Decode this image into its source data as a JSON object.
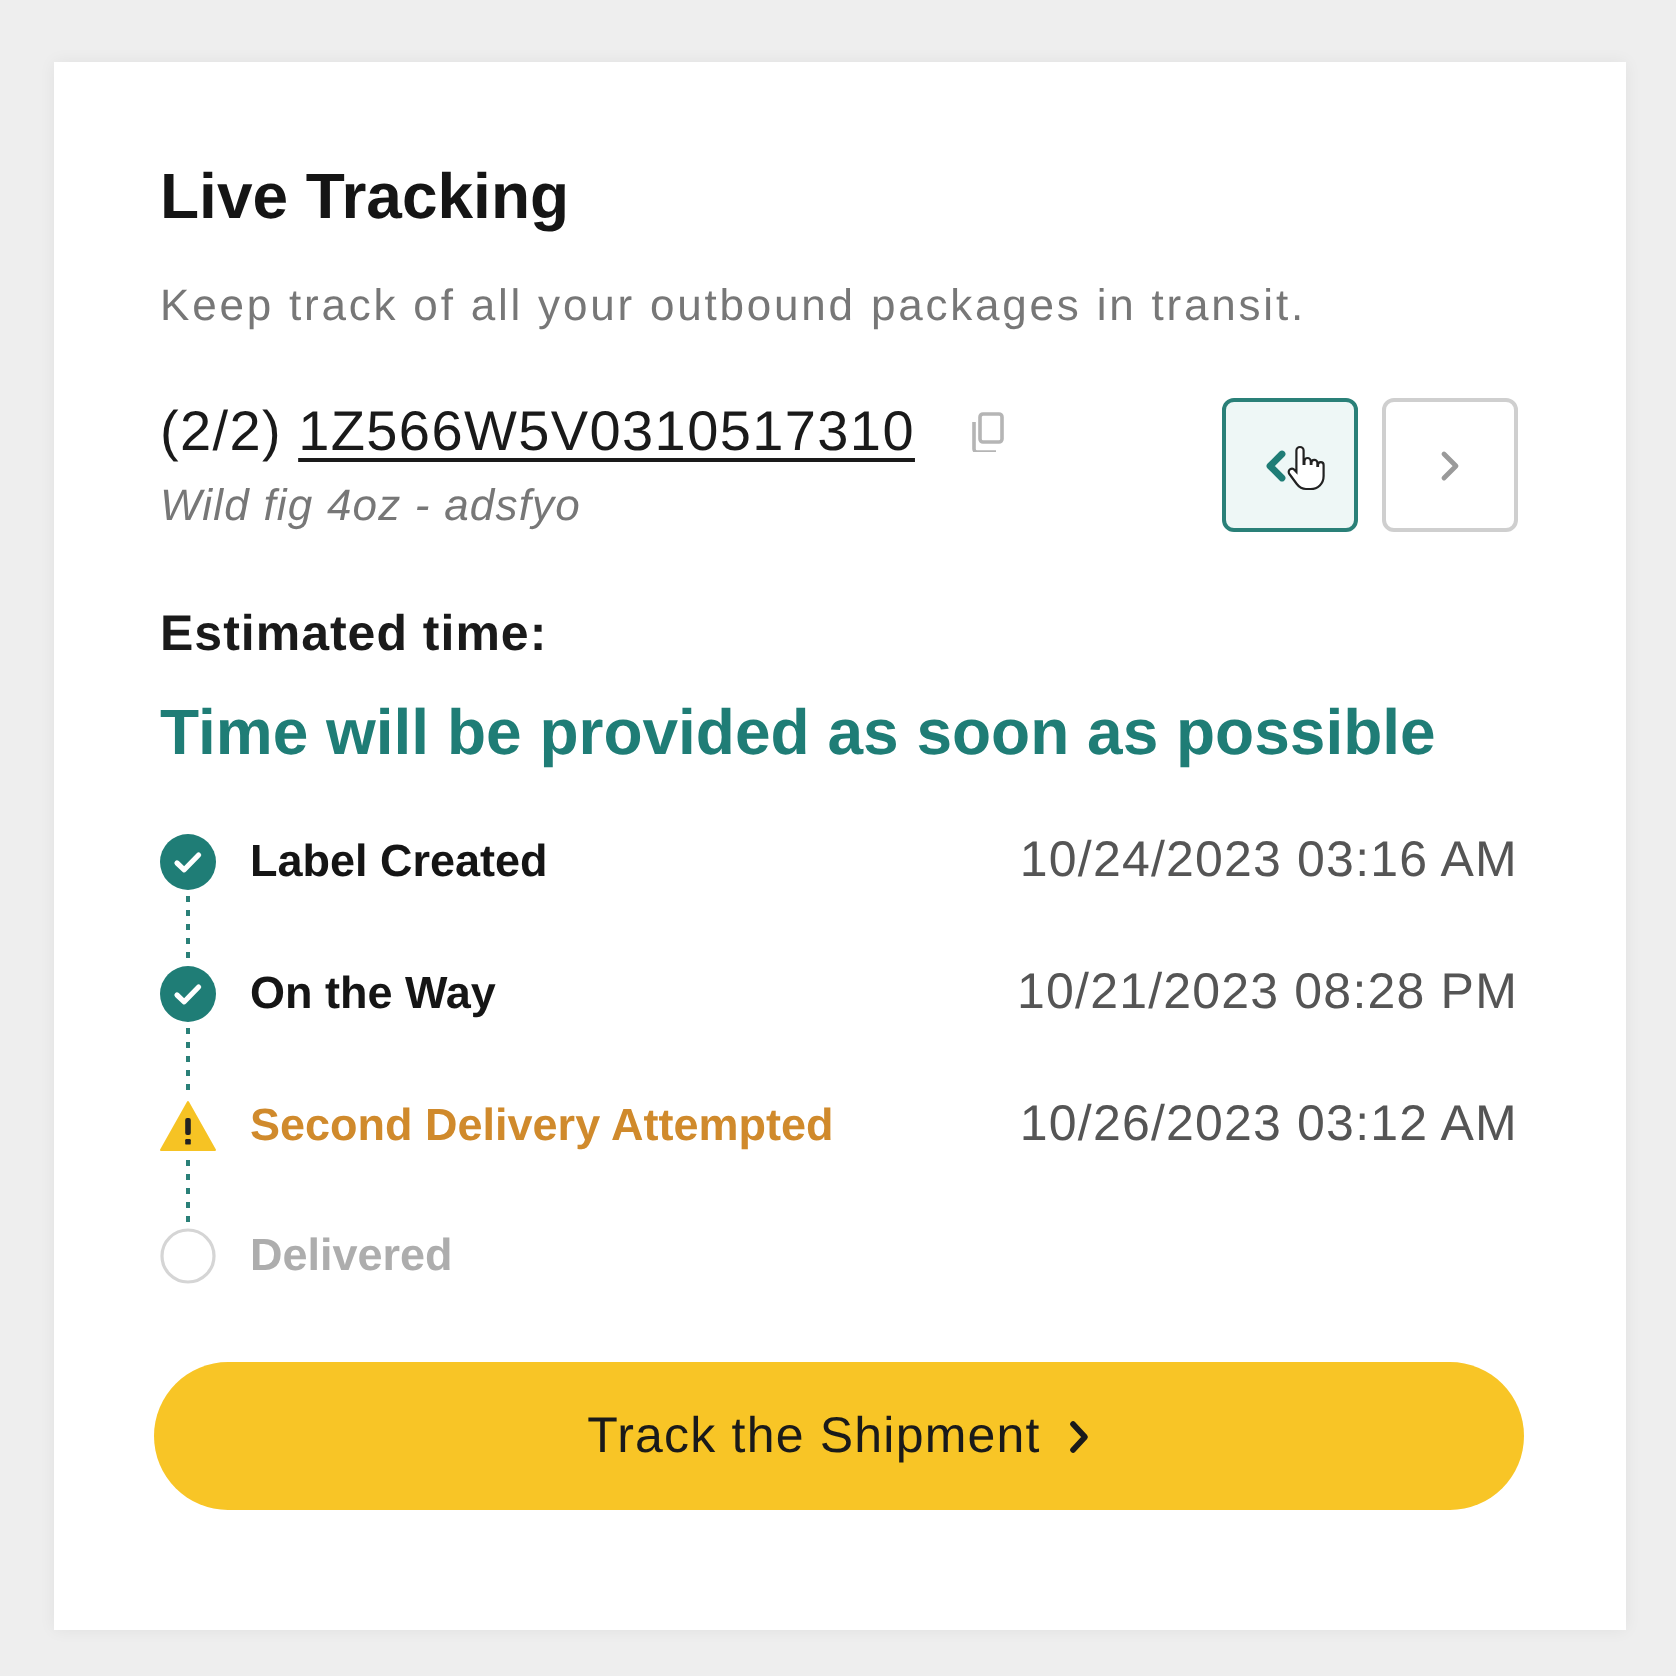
{
  "card": {
    "title": "Live Tracking",
    "subtitle": "Keep track of all your outbound packages in transit."
  },
  "shipment": {
    "counter": "(2/2)",
    "tracking_number": "1Z566W5V0310517310",
    "item": "Wild fig 4oz - adsfyo"
  },
  "pager": [
    {
      "kind": "previous",
      "hovered": true
    },
    {
      "kind": "next",
      "hovered": false
    }
  ],
  "estimate": {
    "label": "Estimated time:",
    "value": "Time will be provided as soon as possible"
  },
  "timeline": [
    {
      "kind": "done",
      "label": "Label Created",
      "time": "10/24/2023 03:16 AM"
    },
    {
      "kind": "done",
      "label": "On the Way",
      "time": "10/21/2023 08:28 PM"
    },
    {
      "kind": "warning",
      "label": "Second Delivery Attempted",
      "time": "10/26/2023 03:12 AM"
    },
    {
      "kind": "pending",
      "label": "Delivered"
    }
  ],
  "action_button": {
    "label": "Track the Shipment"
  }
}
